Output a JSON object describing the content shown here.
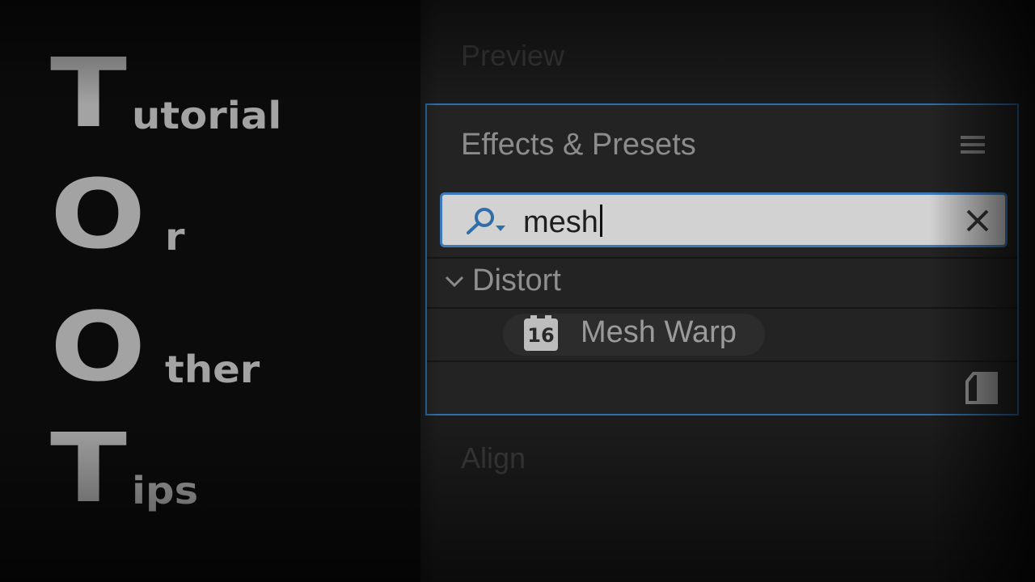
{
  "title_acronym": [
    {
      "initial": "T",
      "rest": "utorial"
    },
    {
      "initial": "O",
      "rest": "r"
    },
    {
      "initial": "O",
      "rest": "ther"
    },
    {
      "initial": "T",
      "rest": "ips"
    }
  ],
  "panels": {
    "preview_title": "Preview",
    "align_title": "Align",
    "effects": {
      "title": "Effects & Presets",
      "search": {
        "value": "mesh",
        "placeholder": ""
      },
      "groups": [
        {
          "label": "Distort",
          "expanded": true,
          "items": [
            {
              "label": "Mesh Warp",
              "badge": "16"
            }
          ]
        }
      ]
    }
  },
  "icons": {
    "search": "search-dropdown-icon",
    "clear": "close-icon",
    "menu": "hamburger-menu-icon",
    "chevron": "chevron-down-icon",
    "effect": "effect-16bpc-icon",
    "new_bin": "new-bin-icon"
  },
  "colors": {
    "accent_blue": "#2f6ea8",
    "title_gray": "#a3a3a3"
  }
}
